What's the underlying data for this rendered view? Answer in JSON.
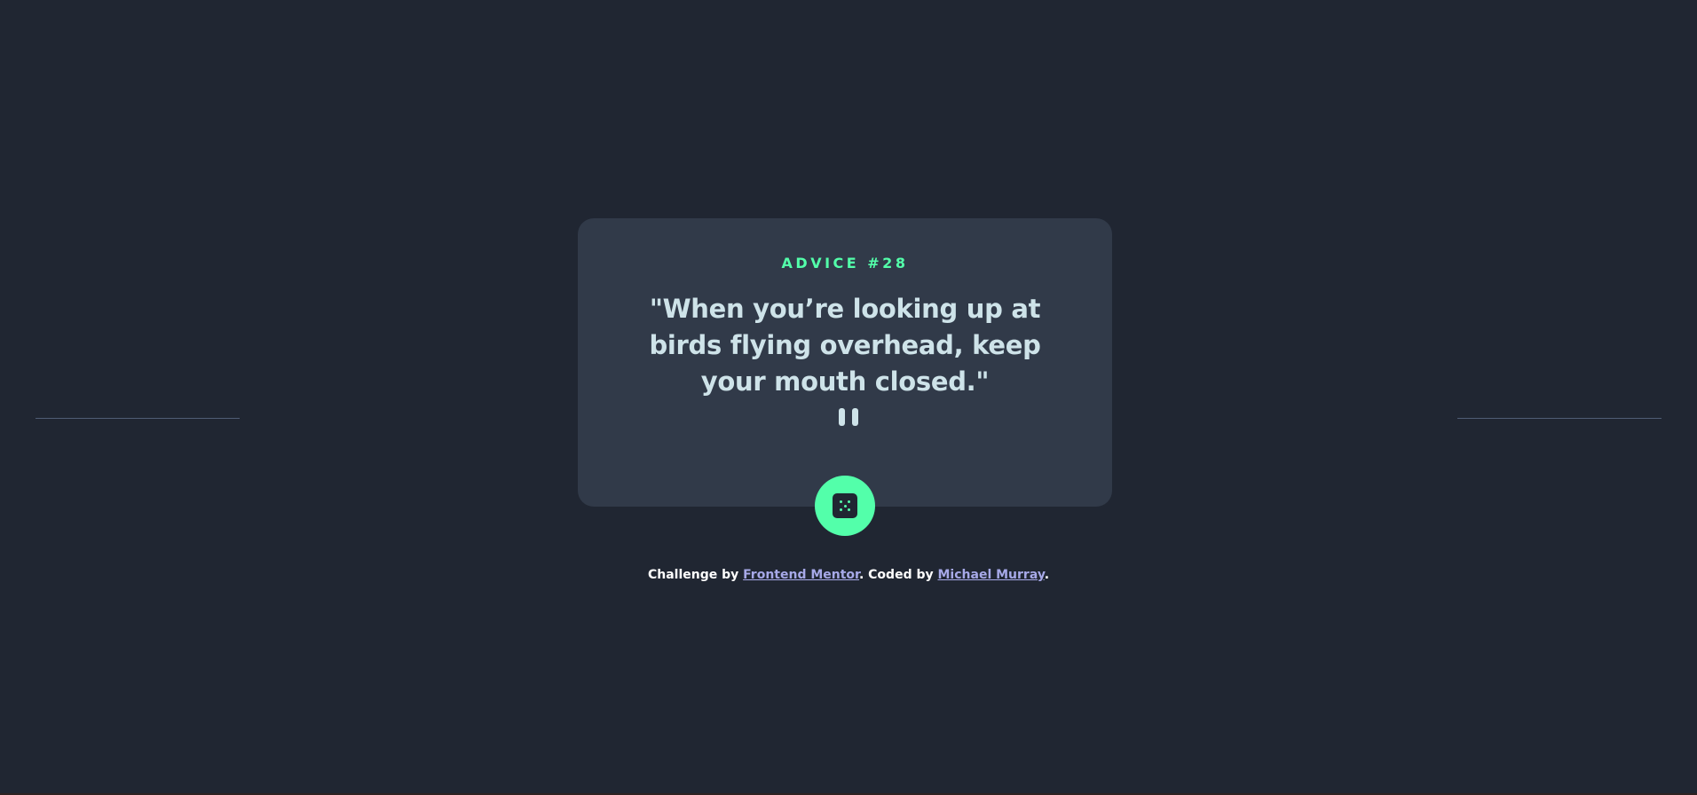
{
  "card": {
    "advice_label": "ADVICE #28",
    "quote": "\"When you’re looking up at birds flying overhead, keep your mouth closed.\""
  },
  "divider": {
    "icon": "pause-icon"
  },
  "button": {
    "icon": "dice-icon"
  },
  "footer": {
    "prefix": "Challenge by",
    "challenge_link": "Frontend Mentor",
    "middle": ". Coded by",
    "author_link": "Michael Murray",
    "suffix": "."
  },
  "colors": {
    "background": "#202632",
    "card": "#313a49",
    "accent": "#53ffaa",
    "text": "#cee3e9",
    "link": "#a7a9e8"
  }
}
